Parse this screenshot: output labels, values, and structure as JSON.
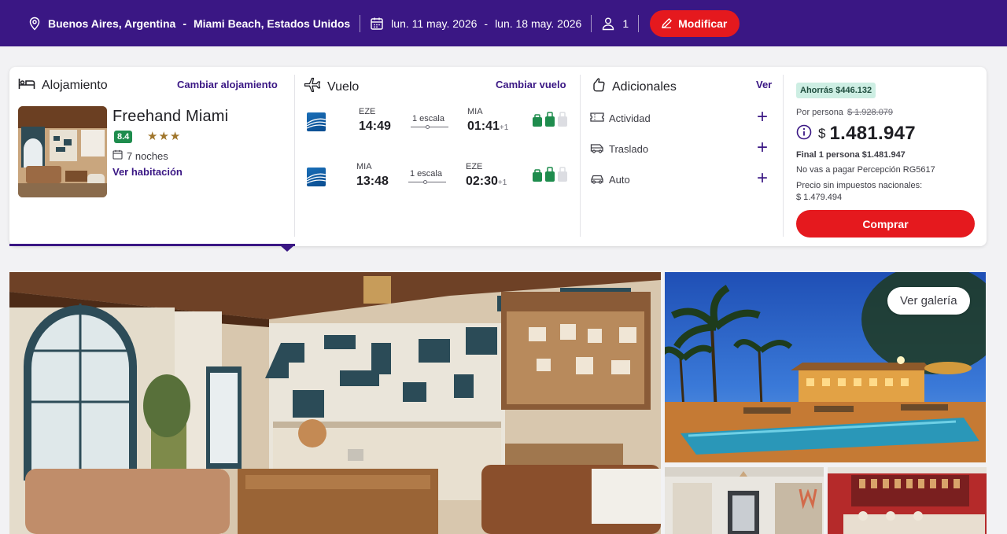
{
  "search": {
    "origin": "Buenos Aires, Argentina",
    "dash": "-",
    "destination": "Miami Beach, Estados Unidos",
    "date_from": "lun. 11 may. 2026",
    "date_dash": "-",
    "date_to": "lun. 18 may. 2026",
    "passengers": "1",
    "modify_label": "Modificar"
  },
  "accommodation": {
    "title": "Alojamiento",
    "change_label": "Cambiar alojamiento",
    "hotel_name": "Freehand Miami",
    "rating": "8.4",
    "stars": "★★★",
    "nights": "7 noches",
    "room_link": "Ver habitación"
  },
  "flight": {
    "title": "Vuelo",
    "change_label": "Cambiar vuelo",
    "legs": [
      {
        "from_code": "EZE",
        "dep_time": "14:49",
        "stops": "1 escala",
        "to_code": "MIA",
        "arr_time": "01:41",
        "day_offset": "+1"
      },
      {
        "from_code": "MIA",
        "dep_time": "13:48",
        "stops": "1 escala",
        "to_code": "EZE",
        "arr_time": "02:30",
        "day_offset": "+1"
      }
    ]
  },
  "extras": {
    "title": "Adicionales",
    "view_label": "Ver",
    "items": [
      {
        "label": "Actividad",
        "icon": "ticket-icon"
      },
      {
        "label": "Traslado",
        "icon": "shuttle-icon"
      },
      {
        "label": "Auto",
        "icon": "car-icon"
      }
    ]
  },
  "price": {
    "savings": "Ahorrás $446.132",
    "per_person_label": "Por persona",
    "old_price": "$ 1.928.079",
    "currency": "$",
    "amount": "1.481.947",
    "final_line": "Final 1 persona $1.481.947",
    "perception_line": "No vas a pagar Percepción RG5617",
    "no_tax_label": "Precio sin impuestos nacionales:",
    "no_tax_value": "$ 1.479.494",
    "buy_label": "Comprar"
  },
  "gallery": {
    "view_label": "Ver galería"
  },
  "colors": {
    "brand_purple": "#3a1784",
    "accent_red": "#e5191e",
    "rating_green": "#1e8c4d",
    "savings_bg": "#cdeee3"
  }
}
